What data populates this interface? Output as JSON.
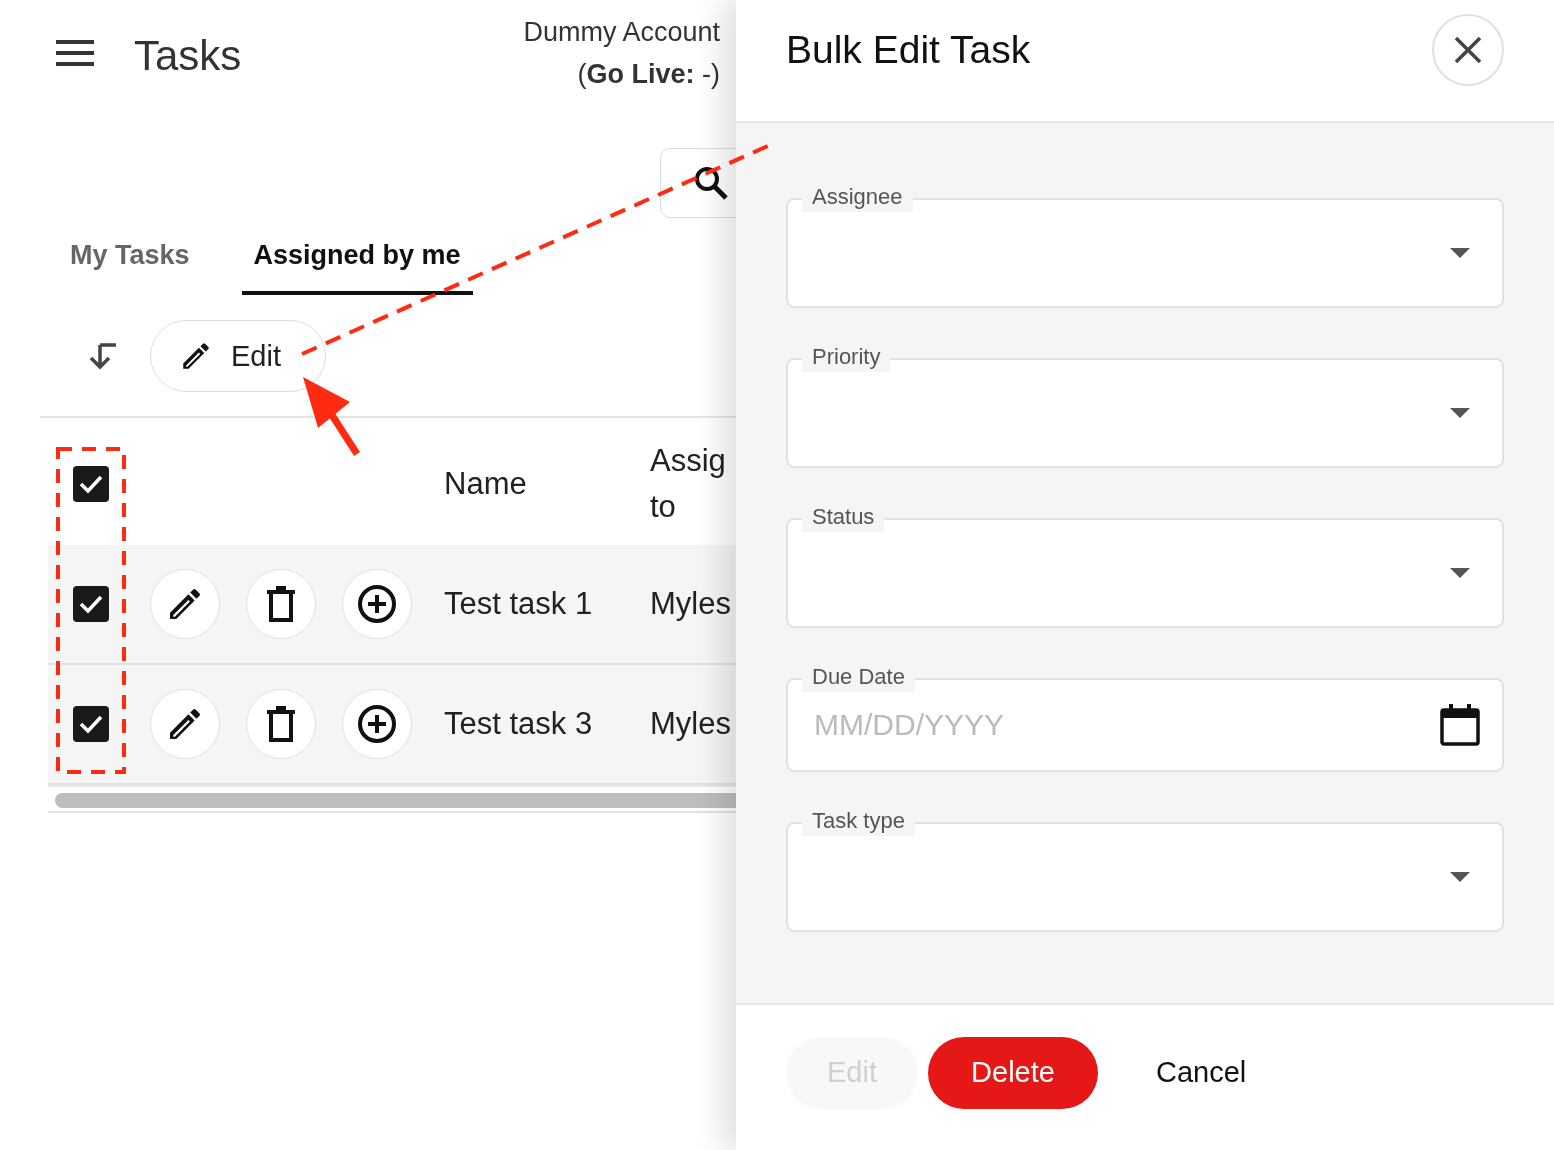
{
  "header": {
    "title": "Tasks",
    "account": "Dummy Account",
    "go_live": "(**Go Live:** -)"
  },
  "tabs": [
    {
      "label": "My Tasks",
      "selected": false
    },
    {
      "label": "Assigned by me",
      "selected": true
    }
  ],
  "toolbar": {
    "edit_button": "Edit"
  },
  "table": {
    "select_all_checked": true,
    "columns": [
      "Name",
      "Assig to"
    ],
    "rows": [
      {
        "checked": true,
        "name": "Test task 1",
        "assigned_to": "Myles"
      },
      {
        "checked": true,
        "name": "Test task 3",
        "assigned_to": "Myles"
      }
    ]
  },
  "drawer": {
    "title": "Bulk Edit Task",
    "fields": [
      {
        "kind": "select",
        "label": "Assignee"
      },
      {
        "kind": "select",
        "label": "Priority"
      },
      {
        "kind": "select",
        "label": "Status"
      },
      {
        "kind": "date",
        "label": "Due Date",
        "placeholder": "MM/DD/YYYY"
      },
      {
        "kind": "select",
        "label": "Task type"
      }
    ],
    "buttons": [
      {
        "kind": "filled",
        "label": "Edit",
        "disabled": true
      },
      {
        "kind": "danger",
        "label": "Delete",
        "disabled": false
      },
      {
        "kind": "text",
        "label": "Cancel",
        "disabled": false
      }
    ]
  }
}
